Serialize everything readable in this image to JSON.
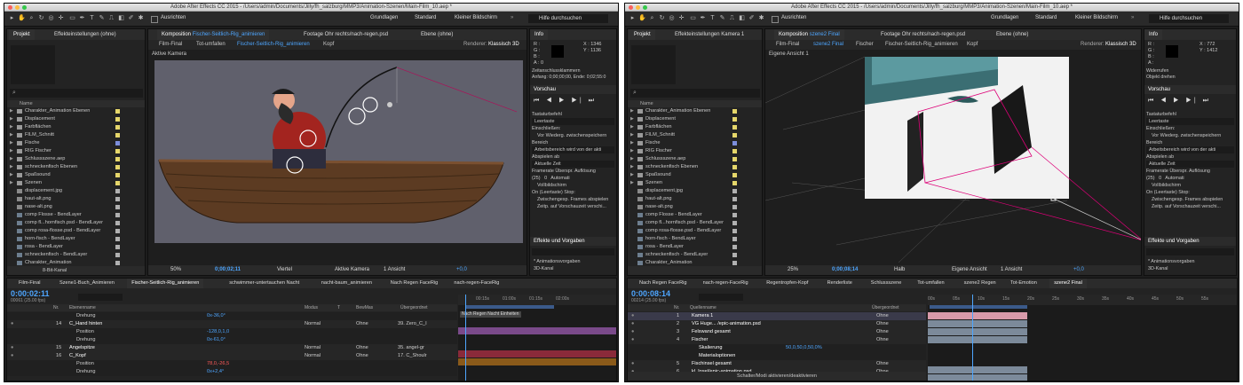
{
  "left": {
    "title": "Adobe After Effects CC 2015 - /Users/admin/Documents/Jilly/fh_salzburg/MMP3/Animation-Szenen/Main-Film_10.aep *",
    "toolbar": {
      "align": "Ausrichten",
      "workspaces": [
        "Grundlagen",
        "Standard",
        "Kleiner Bildschirm"
      ],
      "search": "Hilfe durchsuchen"
    },
    "project_tabs": [
      "Projekt",
      "Effekteinstellungen (ohne)"
    ],
    "project_col_header": "Name",
    "project_items": [
      {
        "name": "Charakter_Animation Ebenen",
        "icon": "folder-icon",
        "color": "#e5d66a"
      },
      {
        "name": "Displacement",
        "icon": "folder-icon",
        "color": "#e5d66a"
      },
      {
        "name": "Farbflächen",
        "icon": "folder-icon",
        "color": "#e5d66a"
      },
      {
        "name": "FILM_Schnitt",
        "icon": "folder-icon",
        "color": "#e5d66a"
      },
      {
        "name": "Fische",
        "icon": "folder-icon",
        "color": "#7c8edb"
      },
      {
        "name": "RIG Fischer",
        "icon": "folder-icon",
        "color": "#e5d66a"
      },
      {
        "name": "Schlussszene.aep",
        "icon": "folder-icon",
        "color": "#e5d66a"
      },
      {
        "name": "schneckenfisch Ebenen",
        "icon": "folder-icon",
        "color": "#e5d66a"
      },
      {
        "name": "Spaßsound",
        "icon": "folder-icon",
        "color": "#e5d66a"
      },
      {
        "name": "Szenen",
        "icon": "folder-icon",
        "color": "#e5d66a"
      },
      {
        "name": "displacement.jpg",
        "icon": "file-icon",
        "color": "#b0b0b0"
      },
      {
        "name": "haut-alt.png",
        "icon": "file-icon",
        "color": "#b0b0b0"
      },
      {
        "name": "nase-alt.png",
        "icon": "file-icon",
        "color": "#b0b0b0"
      },
      {
        "name": "comp Flosse - BendLayer",
        "icon": "comp-icon",
        "color": "#b0b0b0"
      },
      {
        "name": "comp fl...hornfisch.psd - BendLayer",
        "icon": "comp-icon",
        "color": "#b0b0b0"
      },
      {
        "name": "comp rosa-flosse.psd - BendLayer",
        "icon": "comp-icon",
        "color": "#b0b0b0"
      },
      {
        "name": "horn-fisch - BendLayer",
        "icon": "comp-icon",
        "color": "#b0b0b0"
      },
      {
        "name": "rosa - BendLayer",
        "icon": "comp-icon",
        "color": "#b0b0b0"
      },
      {
        "name": "schneckenfisch - BendLayer",
        "icon": "comp-icon",
        "color": "#b0b0b0"
      },
      {
        "name": "Charakter_Animation",
        "icon": "comp-icon",
        "color": "#b0b0b0"
      }
    ],
    "project_footer": "8-Bit-Kanal",
    "comp_tabs": [
      {
        "label": "Komposition",
        "name": "Fischer-Seitlich-Rig_animieren"
      },
      {
        "label": "Footage Ohr rechts/nach-regen.psd"
      },
      {
        "label": "Ebene (ohne)"
      }
    ],
    "breadcrumbs": [
      "Film-Final",
      "Tot-umfallen",
      "Fischer-Seitlich-Rig_animieren",
      "Kopf"
    ],
    "renderer_label": "Renderer:",
    "renderer_value": "Klassisch 3D",
    "viewport_label": "Aktive Kamera",
    "viewer_bar": {
      "zoom": "50%",
      "time": "0;00;02;11",
      "res": "Viertel",
      "view": "Aktive Kamera",
      "views": "1 Ansicht",
      "exposure": "+0,0"
    },
    "info": {
      "title": "Info",
      "r": "R :",
      "g": "G :",
      "b": "B :",
      "a": "A : 0",
      "x": "X : 1346",
      "y": "Y : 1136",
      "marker_title": "Zeitanschlussklammern",
      "marker_detail": "Anfang: 0;00;00;00, Ende: 0;02;55:0"
    },
    "preview": {
      "title": "Vorschau",
      "shortcut_label": "Tastaturbefehl",
      "shortcut_value": "Leertaste",
      "include_label": "Einschließen:",
      "replay": "Vor Wiederg. zwischenspeichern",
      "range_label": "Bereich",
      "range_value": "Arbeitsbereich wird von der akti",
      "play_from_label": "Abspielen ab",
      "play_from_value": "Aktuelle Zeit",
      "fps_label": "Framerate",
      "skip_label": "Überspr.",
      "res_label": "Auflösung",
      "fps_value": "(25)",
      "skip_value": "0",
      "res_value": "Automati",
      "fullscreen": "Vollbildschirm",
      "stop_label": "On (Leertaste) Stop:",
      "cache": "Zwischengesp. Frames abspielen",
      "move_time": "Zeitp. auf Vorschauzeit verschi..."
    },
    "effects": {
      "title": "Effekte und Vorgaben",
      "items": [
        "* Animationsvorgaben",
        "3D-Kanal"
      ]
    },
    "timeline_tabs": [
      "Film-Final",
      "Szene1-Buch_Animieren",
      "Fischer-Seitlich-Rig_animieren",
      "schwimmer-untertauchen Nacht",
      "nacht-baum_animieren",
      "Nach Regen FaceRig",
      "nach-regen-FaceRig"
    ],
    "timecode": "0:00:02:11",
    "timecode_sub": "00061 (25.00 fps)",
    "layer_headers": {
      "nr": "Nr.",
      "name": "Ebenenname",
      "mode": "Modus",
      "t": "T",
      "trackmat": "BewMas",
      "parent": "Übergeordnet"
    },
    "layers": [
      {
        "nr": "",
        "name": "Drehung",
        "value": "0x-36,0°",
        "mode": "",
        "trk": "",
        "parent": "",
        "prop": true
      },
      {
        "nr": "14",
        "name": "C_Hand hinten",
        "value": "",
        "mode": "Normal",
        "trk": "Ohne",
        "parent": "39. Zero_C_I",
        "prop": false
      },
      {
        "nr": "",
        "name": "Position",
        "value": "-128,0,1,0",
        "mode": "",
        "trk": "",
        "parent": "",
        "prop": true
      },
      {
        "nr": "",
        "name": "Drehung",
        "value": "0x-61,0°",
        "mode": "",
        "trk": "",
        "parent": "",
        "prop": true
      },
      {
        "nr": "15",
        "name": "Angelspitze",
        "value": "",
        "mode": "Normal",
        "trk": "Ohne",
        "parent": "35. angel-gr",
        "prop": false
      },
      {
        "nr": "16",
        "name": "C_Kopf",
        "value": "",
        "mode": "Normal",
        "trk": "Ohne",
        "parent": "17. C_Shoulr",
        "prop": false
      },
      {
        "nr": "",
        "name": "Position",
        "value": "78,0,-26,5",
        "mode": "",
        "trk": "",
        "parent": "",
        "prop": true
      },
      {
        "nr": "",
        "name": "Drehung",
        "value": "0x+2,4°",
        "mode": "",
        "trk": "",
        "parent": "",
        "prop": true
      }
    ],
    "ruler": [
      "00:15s",
      "01:00s",
      "01:15s",
      "02:00s"
    ],
    "marker_text": "Nach Regen Nacht Einheiten"
  },
  "right": {
    "title": "Adobe After Effects CC 2015 - /Users/admin/Documents/Jilly/fh_salzburg/MMP3/Animation-Szenen/Main-Film_10.aep *",
    "toolbar": {
      "align": "Ausrichten",
      "workspaces": [
        "Grundlagen",
        "Standard",
        "Kleiner Bildschirm"
      ],
      "search": "Hilfe durchsuchen"
    },
    "project_tabs": [
      "Projekt",
      "Effekteinstellungen Kamera 1"
    ],
    "comp_tabs": [
      {
        "label": "Komposition",
        "name": "szene2 Final"
      },
      {
        "label": "Footage Ohr rechts/nach-regen.psd"
      },
      {
        "label": "Ebene (ohne)"
      }
    ],
    "breadcrumbs": [
      "Film-Final",
      "szene2 Final",
      "Fischer",
      "Fischer-Seitlich-Rig_animieren",
      "Kopf"
    ],
    "renderer_label": "Renderer:",
    "renderer_value": "Klassisch 3D",
    "viewport_label": "Eigene Ansicht 1",
    "viewer_bar": {
      "zoom": "25%",
      "time": "0;00;08;14",
      "res": "Halb",
      "view": "Eigene Ansicht",
      "views": "1 Ansicht",
      "exposure": "+0,0"
    },
    "info": {
      "title": "Info",
      "r": "R :",
      "g": "G :",
      "b": "B :",
      "a": "A :",
      "x": "X : 772",
      "y": "Y : 1412",
      "marker_title": "Widerrufen",
      "marker_detail": "Objekt drehen"
    },
    "timeline_tabs": [
      "Nach Regen FaceRig",
      "nach-regen-FaceRig",
      "Regentropfen-Kopf",
      "Renderliste",
      "Schlussszene",
      "Tot-umfallen",
      "szene2 Regen",
      "Tot-Emotion",
      "szene2 Final"
    ],
    "timecode": "0:00:08:14",
    "timecode_sub": "00214 (25.00 fps)",
    "layer_headers": {
      "nr": "Nr.",
      "name": "Quellenname",
      "mode": "Modus",
      "parent": "Übergeordnet"
    },
    "layers": [
      {
        "nr": "1",
        "name": "Kamera 1",
        "mode": "",
        "trk": "",
        "parent": "Ohne",
        "prop": false,
        "sel": true
      },
      {
        "nr": "2",
        "name": "VG Huge... /epic-animation.psd",
        "mode": "",
        "trk": "",
        "parent": "Ohne",
        "prop": false
      },
      {
        "nr": "3",
        "name": "Felswand gesamt",
        "mode": "",
        "trk": "",
        "parent": "Ohne",
        "prop": false
      },
      {
        "nr": "4",
        "name": "Fischer",
        "mode": "",
        "trk": "",
        "parent": "Ohne",
        "prop": false
      },
      {
        "nr": "",
        "name": "Skalierung",
        "value": "50,0,50,0,50,0%",
        "mode": "",
        "trk": "",
        "parent": "",
        "prop": true
      },
      {
        "nr": "",
        "name": "Materialoptionen",
        "mode": "",
        "trk": "",
        "parent": "",
        "prop": true
      },
      {
        "nr": "5",
        "name": "Fischinsel gesamt",
        "mode": "",
        "trk": "",
        "parent": "Ohne",
        "prop": false
      },
      {
        "nr": "6",
        "name": "kl. Insel/epic-animation.psd",
        "mode": "",
        "trk": "",
        "parent": "Ohne",
        "prop": false
      }
    ],
    "ruler": [
      "00s",
      "05s",
      "10s",
      "15s",
      "20s",
      "25s",
      "30s",
      "35s",
      "40s",
      "45s",
      "50s",
      "55s"
    ],
    "footer": "Schalter/Modi aktivieren/deaktivieren"
  },
  "colors": {
    "accent": "#4ea6ff",
    "highlight": "#3d9bff",
    "timeline_bar": "#7a4a8a"
  }
}
